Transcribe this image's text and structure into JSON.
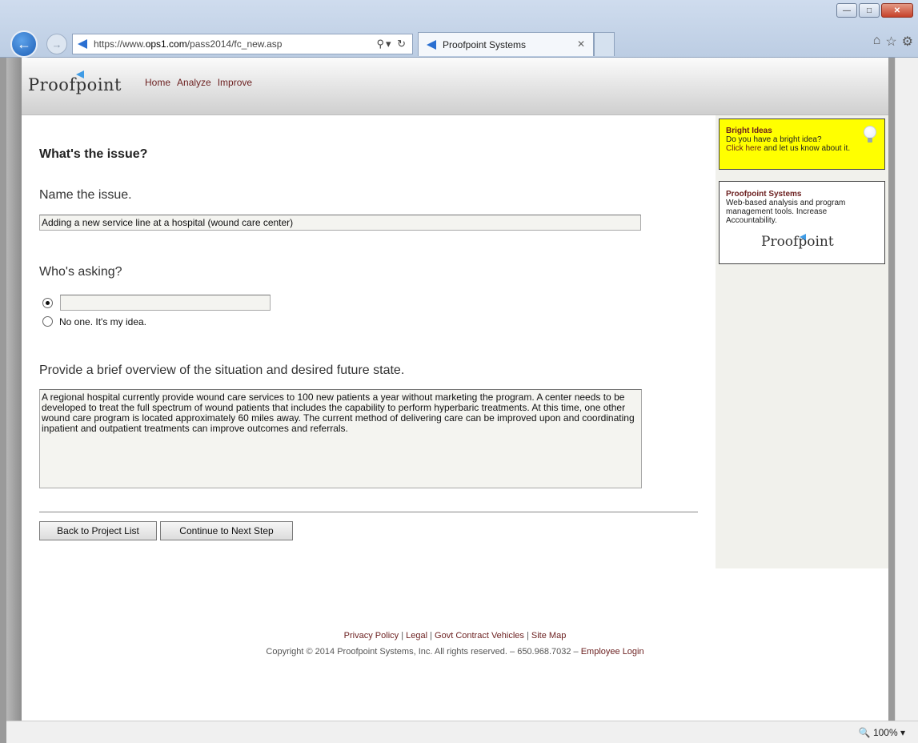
{
  "browser": {
    "url_prefix": "https://www.",
    "url_domain": "ops1.com",
    "url_path": "/pass2014/fc_new.asp",
    "tab_title": "Proofpoint Systems",
    "zoom": "100%"
  },
  "header": {
    "logo_text": "Proofpoint",
    "nav": [
      "Home",
      "Analyze",
      "Improve"
    ]
  },
  "form": {
    "title": "What's the issue?",
    "name_label": "Name the issue.",
    "name_value": "Adding a new service line at a hospital (wound care center)",
    "asking_label": "Who's asking?",
    "asker_value": "",
    "no_one_label": "No one. It's my idea.",
    "overview_label": "Provide a brief overview of the situation and desired future state.",
    "overview_value": "A regional hospital currently provide wound care services to 100 new patients a year without marketing the program. A center needs to be developed to treat the full spectrum of wound patients that includes the capability to perform hyperbaric treatments. At this time, one other wound care program is located approximately 60 miles away. The current method of delivering care can be improved upon and coordinating inpatient and outpatient treatments can improve outcomes and referrals.",
    "back_button": "Back to Project List",
    "continue_button": "Continue to Next Step"
  },
  "sidebar": {
    "ideas_title": "Bright Ideas",
    "ideas_line1": "Do you have a bright idea?",
    "ideas_link": "Click here",
    "ideas_line2": " and let us know about it.",
    "systems_title": "Proofpoint Systems",
    "systems_text": "Web-based analysis and program management tools. Increase Accountability.",
    "systems_logo": "Proofpoint"
  },
  "footer": {
    "links": [
      "Privacy Policy",
      "Legal",
      "Govt Contract Vehicles",
      "Site Map"
    ],
    "copyright": "Copyright © 2014 Proofpoint Systems, Inc. All rights reserved. – 650.968.7032 – ",
    "employee_login": "Employee Login"
  },
  "colors": {
    "accent_link": "#6b1f1f",
    "ideas_bg": "#ffff00",
    "logo_triangle": "#3f9be5"
  }
}
